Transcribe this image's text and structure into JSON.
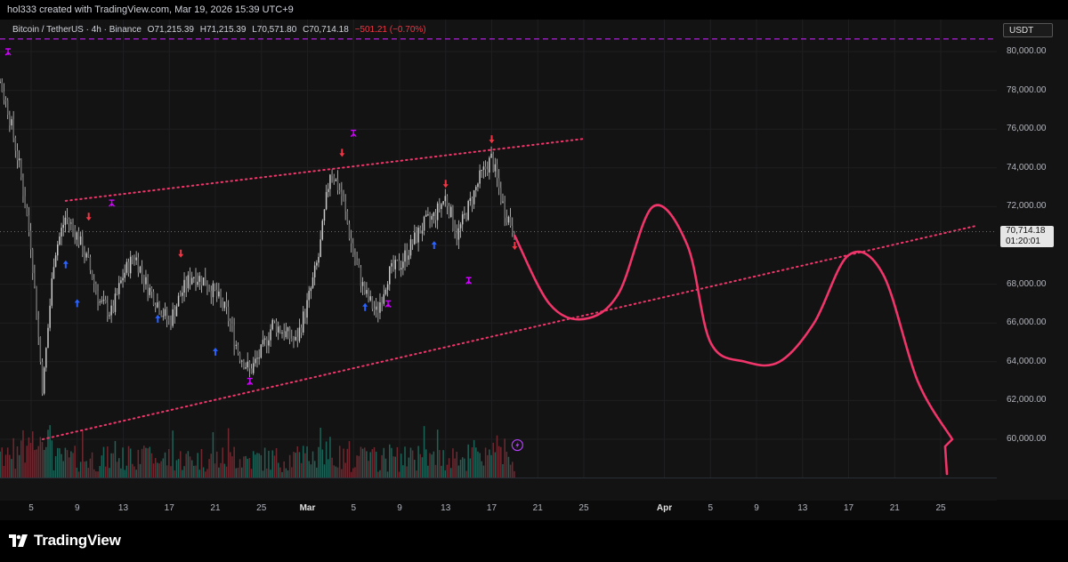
{
  "header": {
    "credit": "hol333 created with TradingView.com, Mar 19, 2026 15:39 UTC+9"
  },
  "symbol": {
    "name": "Bitcoin / TetherUS · 4h · Binance",
    "open": "O71,215.39",
    "high": "H71,215.39",
    "low": "L70,571.80",
    "close": "C70,714.18",
    "change": "−501.21 (−0.70%)"
  },
  "currency": "USDT",
  "last_price": {
    "value": "70,714.18",
    "countdown": "01:20:01"
  },
  "price_axis": {
    "labels": [
      "80,000.00",
      "78,000.00",
      "76,000.00",
      "74,000.00",
      "72,000.00",
      "68,000.00",
      "66,000.00",
      "64,000.00",
      "62,000.00",
      "60,000.00"
    ]
  },
  "time_axis": {
    "labels": [
      "5",
      "9",
      "13",
      "17",
      "21",
      "25",
      "Mar",
      "5",
      "9",
      "13",
      "17",
      "21",
      "25",
      "Apr",
      "5",
      "9",
      "13",
      "17",
      "21",
      "25"
    ],
    "major": [
      "Mar",
      "Apr"
    ]
  },
  "footer": {
    "brand": "TradingView"
  },
  "colors": {
    "background": "#131313",
    "candle": "#c8c8c8",
    "trendline": "#f0356a",
    "projection": "#f0356a",
    "alert_line": "#c020f0",
    "sell_signal": "#f23645",
    "buy_signal": "#2962ff",
    "magenta_signal": "#d000ff",
    "volume_up": "#1f6b5e",
    "volume_down": "#7a2b33"
  },
  "chart_data": {
    "type": "line",
    "title": "",
    "xlabel": "",
    "ylabel": "",
    "timeframe": "4h",
    "ylim": [
      59000,
      81000
    ],
    "x_start": "2026-02-02",
    "x_end": "2026-03-29",
    "series": [
      {
        "role": "price",
        "x": [
          "2026-02-02",
          "2026-02-03",
          "2026-02-04",
          "2026-02-05",
          "2026-02-06",
          "2026-02-07",
          "2026-02-08",
          "2026-02-09",
          "2026-02-10",
          "2026-02-11",
          "2026-02-12",
          "2026-02-13",
          "2026-02-14",
          "2026-02-15",
          "2026-02-16",
          "2026-02-17",
          "2026-02-18",
          "2026-02-19",
          "2026-02-20",
          "2026-02-21",
          "2026-02-22",
          "2026-02-23",
          "2026-02-24",
          "2026-02-25",
          "2026-02-26",
          "2026-02-27",
          "2026-02-28",
          "2026-03-01",
          "2026-03-02",
          "2026-03-03",
          "2026-03-04",
          "2026-03-05",
          "2026-03-06",
          "2026-03-07",
          "2026-03-08",
          "2026-03-09",
          "2026-03-10",
          "2026-03-11",
          "2026-03-12",
          "2026-03-13",
          "2026-03-14",
          "2026-03-15",
          "2026-03-16",
          "2026-03-17",
          "2026-03-18",
          "2026-03-19"
        ],
        "values": [
          79000,
          77000,
          74000,
          70000,
          62500,
          69500,
          71500,
          70500,
          69000,
          67000,
          66500,
          68500,
          69500,
          68000,
          67000,
          66000,
          67500,
          68500,
          68200,
          67500,
          66500,
          64500,
          63500,
          64500,
          66000,
          65500,
          65000,
          67000,
          69500,
          74000,
          72500,
          69500,
          67500,
          66500,
          68500,
          69000,
          70000,
          71000,
          71500,
          72500,
          70500,
          72000,
          73500,
          74500,
          72000,
          70700
        ]
      },
      {
        "role": "projection",
        "x": [
          "2026-03-19",
          "2026-03-22",
          "2026-03-25",
          "2026-03-28",
          "2026-03-31",
          "2026-04-03",
          "2026-04-05",
          "2026-04-08",
          "2026-04-11",
          "2026-04-14",
          "2026-04-17",
          "2026-04-20",
          "2026-04-23",
          "2026-04-26"
        ],
        "values": [
          70500,
          67000,
          66200,
          67500,
          72000,
          70000,
          65000,
          64000,
          64000,
          66000,
          69500,
          68500,
          63000,
          60000
        ]
      },
      {
        "role": "upper_trendline",
        "x": [
          "2026-02-08",
          "2026-03-25"
        ],
        "values": [
          72300,
          75500
        ]
      },
      {
        "role": "lower_trendline",
        "x": [
          "2026-02-06",
          "2026-04-28"
        ],
        "values": [
          60000,
          71000
        ]
      },
      {
        "role": "alert_level",
        "x": [
          "2026-02-01",
          "2026-04-28"
        ],
        "values": [
          80650,
          80650
        ]
      }
    ],
    "grid": true,
    "legend": "none"
  }
}
